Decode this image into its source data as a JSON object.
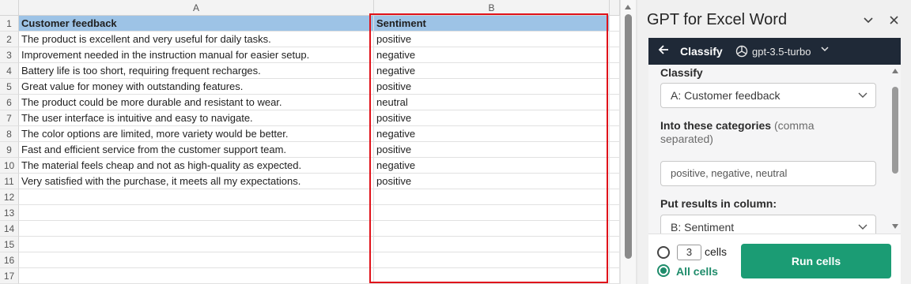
{
  "sheet": {
    "columns": [
      "A",
      "B"
    ],
    "row_numbers": [
      "1",
      "2",
      "3",
      "4",
      "5",
      "6",
      "7",
      "8",
      "9",
      "10",
      "11",
      "12",
      "13",
      "14",
      "15",
      "16",
      "17"
    ],
    "rows": [
      [
        "Customer feedback",
        "Sentiment"
      ],
      [
        "The product is excellent and very useful for daily tasks.",
        "positive"
      ],
      [
        "Improvement needed in the instruction manual for easier setup.",
        "negative"
      ],
      [
        "Battery life is too short, requiring frequent recharges.",
        "negative"
      ],
      [
        "Great value for money with outstanding features.",
        "positive"
      ],
      [
        "The product could be more durable and resistant to wear.",
        "neutral"
      ],
      [
        "The user interface is intuitive and easy to navigate.",
        "positive"
      ],
      [
        "The color options are limited, more variety would be better.",
        "negative"
      ],
      [
        "Fast and efficient service from the customer support team.",
        "positive"
      ],
      [
        "The material feels cheap and not as high-quality as expected.",
        "negative"
      ],
      [
        "Very satisfied with the purchase, it meets all my expectations.",
        "positive"
      ],
      [
        "",
        ""
      ],
      [
        "",
        ""
      ],
      [
        "",
        ""
      ],
      [
        "",
        ""
      ],
      [
        "",
        ""
      ],
      [
        "",
        ""
      ]
    ],
    "header_fill_color": "#9dc3e6",
    "highlight_border_color": "#e0121a"
  },
  "pane": {
    "title": "GPT for Excel Word",
    "collapse_icon": "chevron-down-icon",
    "close_icon": "close-icon",
    "nav": {
      "back_icon": "arrow-left-icon",
      "title": "Classify",
      "model_icon": "openai-icon",
      "model": "gpt-3.5-turbo"
    },
    "form": {
      "classify_label": "Classify",
      "classify_value": "A: Customer feedback",
      "categories_label": "Into these categories",
      "categories_hint": "(comma separated)",
      "categories_value": "positive, negative, neutral",
      "results_label": "Put results in column:",
      "results_value": "B: Sentiment"
    },
    "footer": {
      "cells_count": "3",
      "cells_label": "cells",
      "all_cells_label": "All cells",
      "run_button": "Run cells",
      "selected_option": "All cells"
    },
    "accent_color": "#1b9c74",
    "navbar_color": "#1f2937"
  }
}
